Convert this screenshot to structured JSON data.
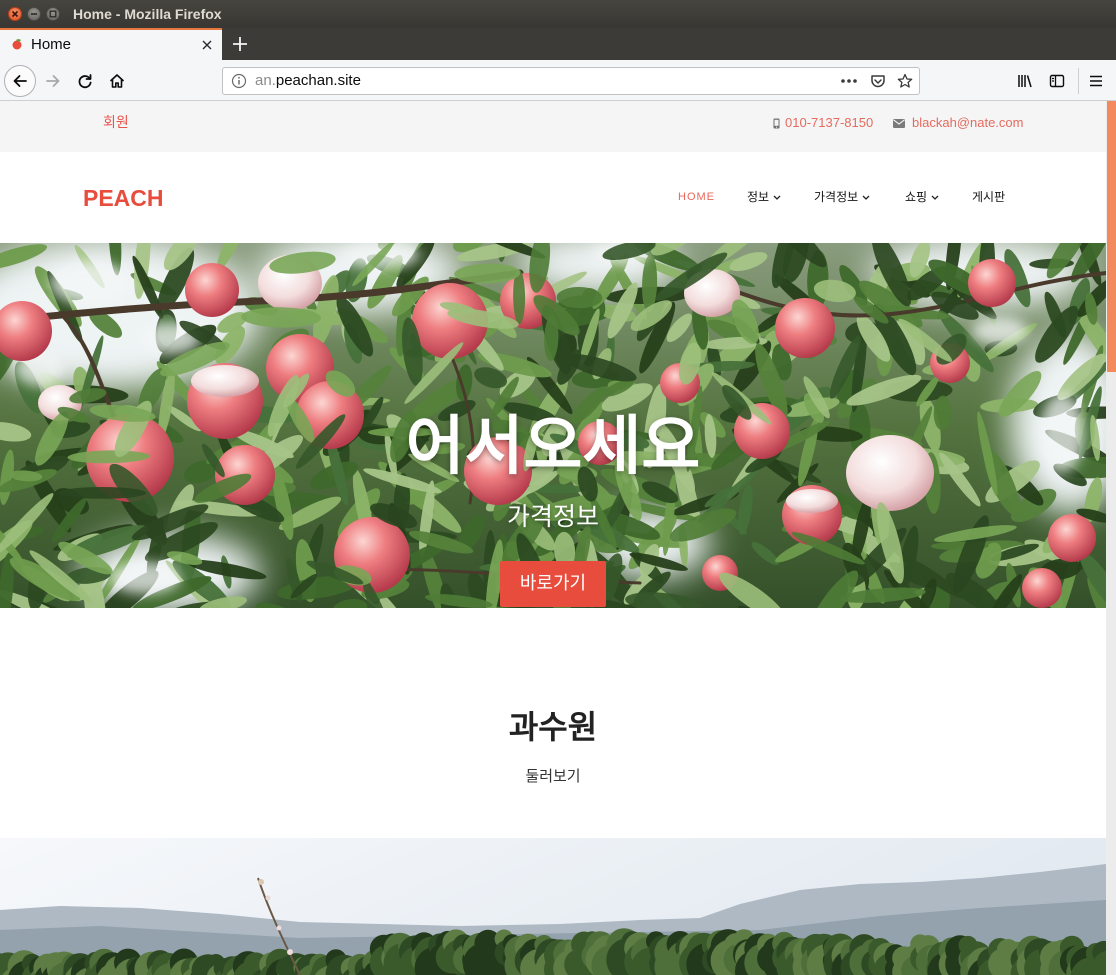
{
  "window": {
    "title": "Home - Mozilla Firefox"
  },
  "browser": {
    "tabs": [
      {
        "label": "Home",
        "active": true
      }
    ],
    "url": {
      "subdomain": "an.",
      "domain": "peachan.site"
    }
  },
  "topbar": {
    "member_label": "회원",
    "phone": "010-7137-8150",
    "email": "blackah@nate.com"
  },
  "header": {
    "logo": "PEACH",
    "nav": [
      {
        "label": "HOME",
        "active": true,
        "has_dropdown": false
      },
      {
        "label": "정보",
        "active": false,
        "has_dropdown": true
      },
      {
        "label": "가격정보",
        "active": false,
        "has_dropdown": true
      },
      {
        "label": "쇼핑",
        "active": false,
        "has_dropdown": true
      },
      {
        "label": "게시판",
        "active": false,
        "has_dropdown": false
      }
    ]
  },
  "hero": {
    "title": "어서오세요",
    "subtitle": "가격정보",
    "button_label": "바로가기"
  },
  "orchard_section": {
    "title": "과수원",
    "subtitle": "둘러보기"
  },
  "scrollbar": {
    "position_fraction": 0.0,
    "visible_fraction": 0.31
  },
  "colors": {
    "accent": "#e84c3d",
    "link": "#e9675b",
    "scroll_thumb": "#f28a5e",
    "titlebar": "#3c3b37",
    "topbar_background": "#f5f5f5"
  },
  "icons": {
    "window_controls": [
      "window-close-icon",
      "window-minimize-icon",
      "window-maximize-icon"
    ],
    "tab": [
      "peach-favicon-icon",
      "tab-close-icon",
      "new-tab-plus-icon"
    ],
    "toolbar": [
      "back-arrow-icon",
      "forward-arrow-icon",
      "reload-icon",
      "home-icon",
      "site-info-icon",
      "page-actions-dots-icon",
      "pocket-icon",
      "bookmark-star-icon",
      "library-icon",
      "sidebar-icon",
      "hamburger-menu-icon"
    ],
    "topbar": [
      "mobile-phone-icon",
      "envelope-icon"
    ],
    "nav": [
      "chevron-down-icon"
    ]
  }
}
